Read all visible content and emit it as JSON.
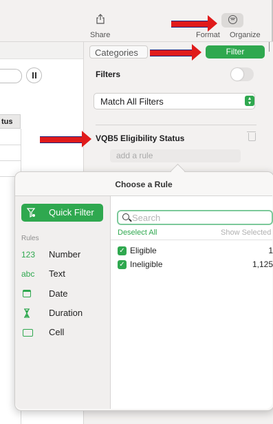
{
  "toolbar": {
    "share_label": "Share",
    "format_label": "Format",
    "organize_label": "Organize"
  },
  "sheet": {
    "column_header": "tus"
  },
  "inspector": {
    "categories_tab": "Categories",
    "filter_tab": "Filter",
    "filters_title": "Filters",
    "filters_enabled": false,
    "match_select": "Match All Filters",
    "filter_column": "VQB5 Eligibility Status",
    "add_rule_placeholder": "add a rule"
  },
  "popover": {
    "title": "Choose a Rule",
    "quick_filter": "Quick Filter",
    "rules_heading": "Rules",
    "rules": [
      {
        "glyph": "123",
        "label": "Number"
      },
      {
        "glyph": "abc",
        "label": "Text"
      },
      {
        "icon": "calendar-icon",
        "label": "Date"
      },
      {
        "icon": "hourglass-icon",
        "label": "Duration"
      },
      {
        "icon": "cell-icon",
        "label": "Cell"
      }
    ],
    "search_placeholder": "Search",
    "deselect_all": "Deselect All",
    "show_selected": "Show Selected",
    "values": [
      {
        "name": "Eligible",
        "count": "1",
        "checked": true
      },
      {
        "name": "Ineligible",
        "count": "1,125",
        "checked": true
      }
    ]
  },
  "colors": {
    "accent_green": "#2fa84f",
    "annotation_red": "#e01b1b"
  }
}
